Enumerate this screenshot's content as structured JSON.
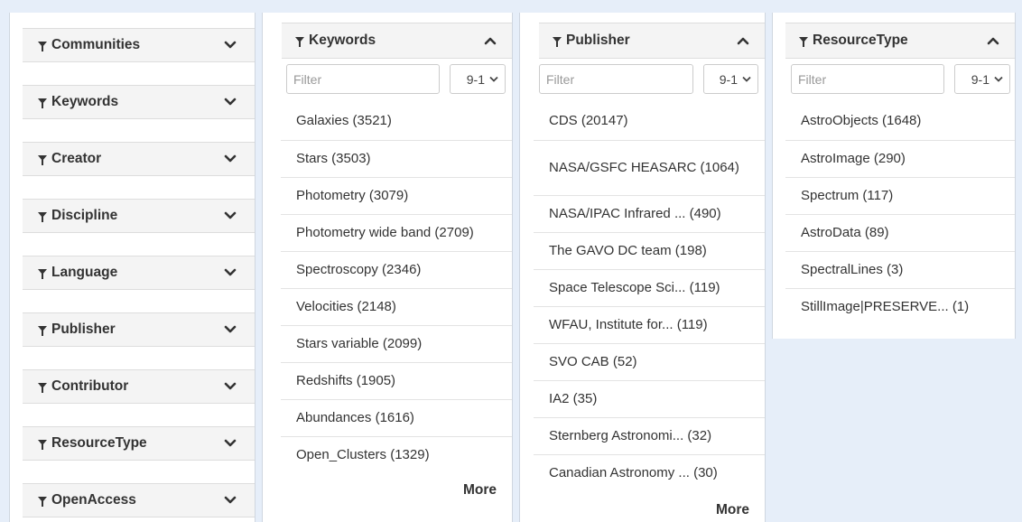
{
  "left_facets": [
    {
      "label": "Communities"
    },
    {
      "label": "Keywords"
    },
    {
      "label": "Creator"
    },
    {
      "label": "Discipline"
    },
    {
      "label": "Language"
    },
    {
      "label": "Publisher"
    },
    {
      "label": "Contributor"
    },
    {
      "label": "ResourceType"
    },
    {
      "label": "OpenAccess"
    }
  ],
  "panels": {
    "keywords": {
      "title": "Keywords",
      "filter_placeholder": "Filter",
      "sort_value": "9-1",
      "items": [
        "Galaxies (3521)",
        "Stars (3503)",
        "Photometry (3079)",
        "Photometry wide band (2709)",
        "Spectroscopy (2346)",
        "Velocities (2148)",
        "Stars variable (2099)",
        "Redshifts (1905)",
        "Abundances (1616)",
        "Open_Clusters (1329)"
      ],
      "more_label": "More"
    },
    "publisher": {
      "title": "Publisher",
      "filter_placeholder": "Filter",
      "sort_value": "9-1",
      "items": [
        "CDS (20147)",
        "NASA/GSFC HEASARC (1064)",
        "NASA/IPAC Infrared ... (490)",
        "The GAVO DC team (198)",
        "Space Telescope Sci... (119)",
        "WFAU, Institute for... (119)",
        "SVO CAB (52)",
        "IA2 (35)",
        "Sternberg Astronomi... (32)",
        "Canadian Astronomy ... (30)"
      ],
      "more_label": "More"
    },
    "resourcetype": {
      "title": "ResourceType",
      "filter_placeholder": "Filter",
      "sort_value": "9-1",
      "items": [
        "AstroObjects (1648)",
        "AstroImage (290)",
        "Spectrum (117)",
        "AstroData (89)",
        "SpectralLines (3)",
        "StillImage|PRESERVE... (1)"
      ]
    }
  },
  "icons": {
    "facet": "filter-icon",
    "collapse": "chevron-up-icon",
    "expand": "chevron-down-icon"
  }
}
